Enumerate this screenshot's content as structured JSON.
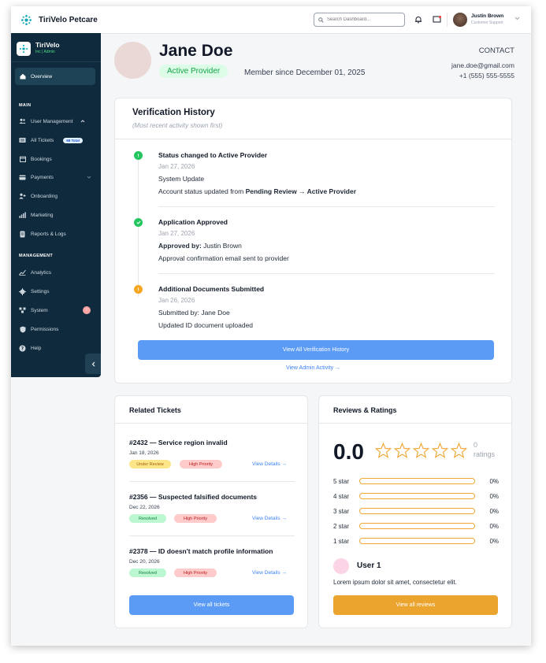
{
  "app": {
    "name": "TiriVelo Petcare"
  },
  "topbar": {
    "search_placeholder": "Search Dashboard...",
    "user_name": "Justin Brown",
    "user_role": "Customer Support"
  },
  "sidebar": {
    "title": "TiriVelo",
    "subtitle": "Inc | Admin",
    "active": "Overview",
    "main_label": "MAIN",
    "management_label": "MANAGEMENT",
    "items": [
      {
        "label": "User Management",
        "icon": "users-icon",
        "chevron": "up"
      },
      {
        "label": "All Tickets",
        "icon": "ticket-icon",
        "badge": "68 Total"
      },
      {
        "label": "Bookings",
        "icon": "calendar-icon"
      },
      {
        "label": "Payments",
        "icon": "card-icon",
        "chevron": "down"
      },
      {
        "label": "Onboarding",
        "icon": "user-plus-icon"
      },
      {
        "label": "Marketing",
        "icon": "bar-chart-icon"
      },
      {
        "label": "Reports & Logs",
        "icon": "report-icon"
      }
    ],
    "management_items": [
      {
        "label": "Analytics",
        "icon": "analytics-icon"
      },
      {
        "label": "Settings",
        "icon": "gear-icon"
      },
      {
        "label": "System",
        "icon": "system-icon",
        "badge": "!"
      },
      {
        "label": "Permissions",
        "icon": "shield-icon"
      },
      {
        "label": "Help",
        "icon": "help-icon"
      }
    ]
  },
  "profile": {
    "name": "Jane Doe",
    "status": "Active Provider",
    "member_since": "Member since December 01, 2025",
    "contact_label": "CONTACT",
    "email": "jane.doe@gmail.com",
    "phone": "+1 (555) 555-5555"
  },
  "verification": {
    "title": "Verification History",
    "subtitle": "(Most recent activity shown first)",
    "events": [
      {
        "title": "Status changed to Active Provider",
        "date": "Jan 27, 2026",
        "line1": "System Update",
        "line2_prefix": "Account status updated from ",
        "line2_from": "Pending Review",
        "line2_arrow": " → ",
        "line2_to": "Active Provider",
        "color": "#22c55e"
      },
      {
        "title": "Application Approved",
        "date": "Jan 27, 2026",
        "line1_label": "Approved by:",
        "line1_value": "Justin Brown",
        "line2": "Approval confirmation email sent to provider",
        "color": "#22c55e"
      },
      {
        "title": "Additional Documents Submitted",
        "date": "Jan 26, 2026",
        "line1": "Submitted by: Jane Doe",
        "line2": "Updated ID document uploaded",
        "color": "#f5a623"
      }
    ],
    "button": "View All Verification History",
    "admin_link": "View Admin Activity →"
  },
  "tickets": {
    "title": "Related Tickets",
    "items": [
      {
        "title": "#2432 — Service region invalid",
        "date": "Jan 18, 2026",
        "status": "Under Review",
        "priority": "High Priority",
        "link": "View Details →"
      },
      {
        "title": "#2356 — Suspected falsified documents",
        "date": "Dec 22, 2026",
        "status": "Resolved",
        "priority": "High Priority",
        "link": "View Details →"
      },
      {
        "title": "#2378 — ID doesn't match profile information",
        "date": "Dec 20, 2026",
        "status": "Resolved",
        "priority": "High Priority",
        "link": "View Details →"
      }
    ],
    "button": "View all tickets"
  },
  "reviews": {
    "title": "Reviews & Ratings",
    "average": "0.0",
    "count": "0",
    "count_label": "ratings",
    "distribution": [
      {
        "label": "5 star",
        "value": 0,
        "pct": "0%"
      },
      {
        "label": "4 star",
        "value": 0,
        "pct": "0%"
      },
      {
        "label": "3 star",
        "value": 0,
        "pct": "0%"
      },
      {
        "label": "2 star",
        "value": 0,
        "pct": "0%"
      },
      {
        "label": "1 star",
        "value": 0,
        "pct": "0%"
      }
    ],
    "reviewer": "User 1",
    "review_text": "Lorem ipsum dolor sit amet, consectetur elit.",
    "button": "View all reviews"
  },
  "colors": {
    "primary_blue": "#5b9bf5",
    "amber": "#f0a735",
    "sidebar_bg": "#0f2a3d",
    "success": "#22c55e"
  }
}
